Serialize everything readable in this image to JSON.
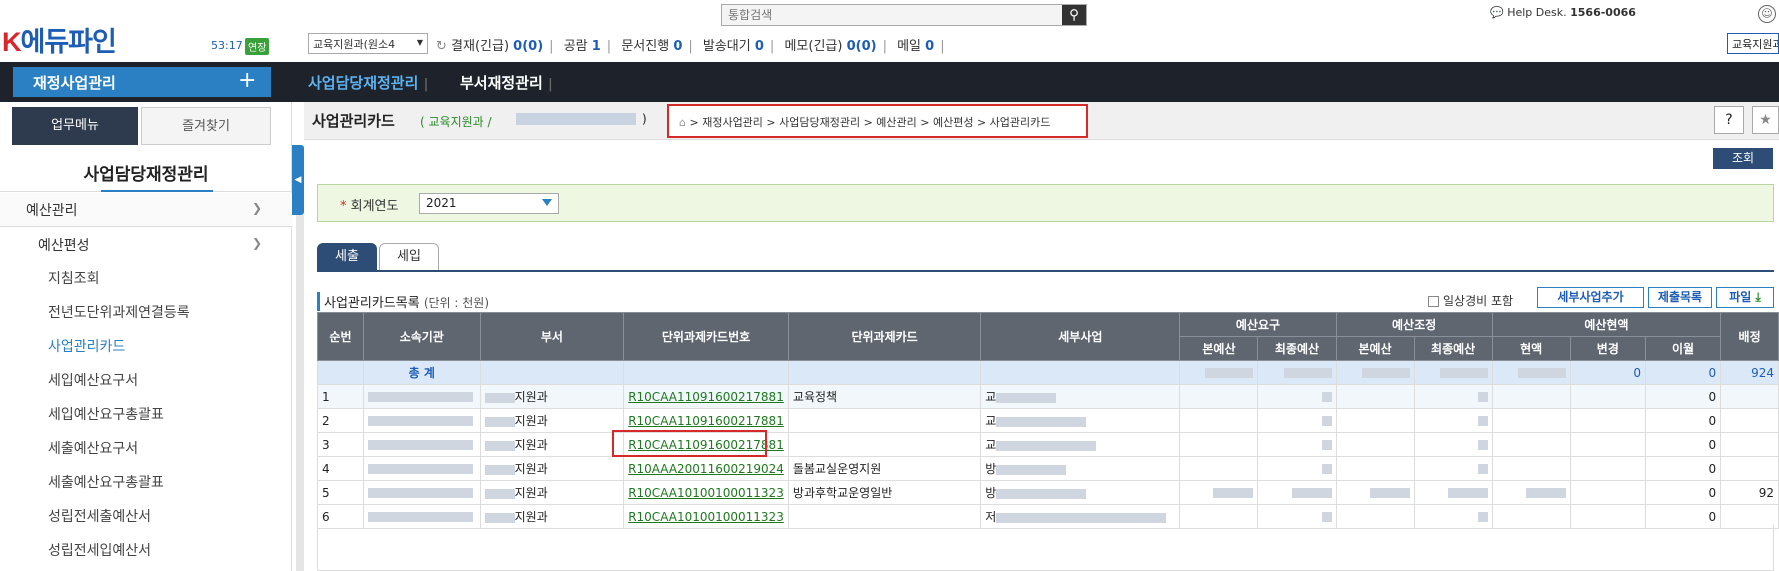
{
  "app": {
    "logo": "K에듀파인",
    "timer": "53:17",
    "extend_label": "연장"
  },
  "search": {
    "placeholder": "통합검색"
  },
  "dept_select": {
    "value": "교육지원과(원소4"
  },
  "status": {
    "approve": "결재(긴급)",
    "approve_count": "0(0)",
    "announce": "공람",
    "announce_count": "1",
    "doc": "문서진행",
    "doc_count": "0",
    "send": "발송대기",
    "send_count": "0",
    "memo": "메모(긴급)",
    "memo_count": "0(0)",
    "mail": "메일",
    "mail_count": "0"
  },
  "helpdesk": {
    "label": "Help Desk.",
    "phone": "1566-0066"
  },
  "right_select": {
    "value": "교육지원과"
  },
  "nav": {
    "main": "재정사업관리",
    "plus": "+",
    "tab1": "사업담당재정관리",
    "tab2": "부서재정관리"
  },
  "sidebar": {
    "tab_work": "업무메뉴",
    "tab_fav": "즐겨찾기",
    "title": "사업담당재정관리",
    "l1": "예산관리",
    "l2": "예산편성",
    "items": [
      "지침조회",
      "전년도단위과제연결등록",
      "사업관리카드",
      "세입예산요구서",
      "세입예산요구총괄표",
      "세출예산요구서",
      "세출예산요구총괄표",
      "성립전세출예산서",
      "성립전세입예산서"
    ]
  },
  "page": {
    "title": "사업관리카드",
    "crumb_dept": "(  교육지원과  /",
    "crumb_end": ")",
    "breadcrumb": "재정사업관리 > 사업담당재정관리 > 예산관리 > 예산편성 > 사업관리카드",
    "query": "조회"
  },
  "filter": {
    "req": "*",
    "label": "회계연도",
    "year": "2021"
  },
  "tabs": {
    "expense": "세출",
    "revenue": "세입"
  },
  "list": {
    "title": "사업관리카드목록",
    "unit": "(단위 : 천원)",
    "chk_label": "일상경비 포함",
    "btn_add": "세부사업추가",
    "btn_submit": "제출목록",
    "btn_file": "파일"
  },
  "table": {
    "groups": [
      "예산요구",
      "예산조정",
      "예산현액"
    ],
    "headers": [
      "순번",
      "소속기관",
      "부서",
      "단위과제카드번호",
      "단위과제카드",
      "세부사업",
      "본예산",
      "최종예산",
      "본예산",
      "최종예산",
      "현액",
      "변경",
      "이월",
      "배정"
    ],
    "total_label": "총 계",
    "total_vals": {
      "change": "0",
      "carry": "0",
      "assign": "924"
    },
    "rows": [
      {
        "no": "1",
        "dept": "지원과",
        "card_no": "R10CAA11091600217881",
        "card": "교육정책",
        "detail": "교",
        "carry": "0",
        "assign": ""
      },
      {
        "no": "2",
        "dept": "지원과",
        "card_no": "R10CAA11091600217881",
        "card": "",
        "detail": "교",
        "carry": "0",
        "assign": ""
      },
      {
        "no": "3",
        "dept": "지원과",
        "card_no": "R10CAA11091600217881",
        "card": "",
        "detail": "교",
        "carry": "0",
        "assign": ""
      },
      {
        "no": "4",
        "dept": "지원과",
        "card_no": "R10AAA20011600219024",
        "card": "돌봄교실운영지원",
        "detail": "방",
        "carry": "0",
        "assign": ""
      },
      {
        "no": "5",
        "dept": "지원과",
        "card_no": "R10CAA10100100011323",
        "card": "방과후학교운영일반",
        "detail": "방",
        "carry": "0",
        "assign": "92"
      },
      {
        "no": "6",
        "dept": "지원과",
        "card_no": "R10CAA10100100011323",
        "card": "",
        "detail": "저",
        "carry": "0",
        "assign": ""
      }
    ]
  },
  "colors": {
    "accent": "#2b80c4",
    "nav_dark": "#1d222b",
    "highlight": "#d62a2a"
  }
}
